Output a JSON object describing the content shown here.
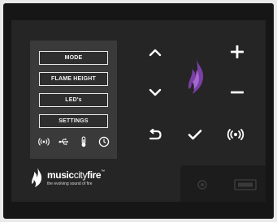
{
  "menu": {
    "items": [
      {
        "label": "MODE"
      },
      {
        "label": "FLAME HEIGHT"
      },
      {
        "label": "LED's"
      },
      {
        "label": "SETTINGS"
      }
    ]
  },
  "status_icons": [
    "wifi-signal-icon",
    "usb-icon",
    "thermometer-icon",
    "clock-icon"
  ],
  "brand": {
    "name_bold": "music",
    "name_light": "city",
    "name_end": "fire",
    "trademark": "™",
    "tagline": "the evolving sound of fire"
  },
  "controls": [
    "up-arrow",
    "plus",
    "down-arrow",
    "minus",
    "back",
    "confirm-check",
    "broadcast"
  ],
  "colors": {
    "bezel": "#161616",
    "panel": "#252525",
    "screen": "#3a3a3a",
    "accent_flame": "#7b3fa6",
    "icon": "#ffffff"
  }
}
